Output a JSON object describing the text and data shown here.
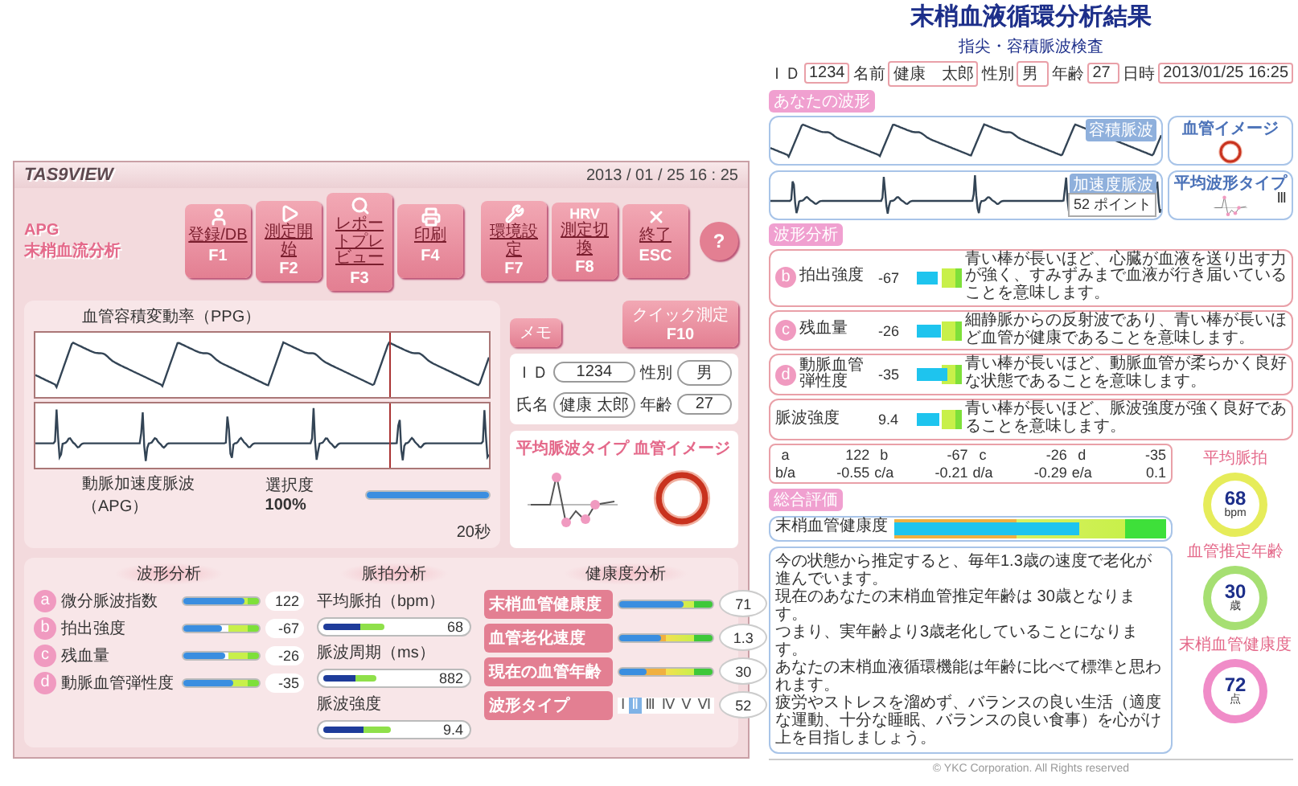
{
  "screen": {
    "app_title": "TAS9VIEW",
    "datetime": "2013 / 01 / 25  16 : 25",
    "logo": {
      "line1": "APG",
      "line2": "末梢血流分析"
    },
    "toolbar": [
      {
        "kind": "person",
        "label": "登録/DB",
        "key": "F1"
      },
      {
        "kind": "play",
        "label": "測定開始",
        "key": "F2"
      },
      {
        "kind": "search",
        "label": "レポートプレビュー",
        "key": "F3"
      },
      {
        "kind": "print",
        "label": "印刷",
        "key": "F4"
      },
      {
        "kind": "tools",
        "label": "環境設定",
        "key": "F7"
      },
      {
        "kind": "hrv",
        "badge": "HRV",
        "label": "測定切換",
        "key": "F8"
      },
      {
        "kind": "close",
        "label": "終了",
        "key": "ESC"
      }
    ],
    "help": "?",
    "ppg_title": "血管容積変動率（PPG）",
    "apg_title": "動脈加速度脈波（APG）",
    "quality": {
      "label": "選択度",
      "value": "100%",
      "level": 1
    },
    "duration": "20秒",
    "memo_button": "メモ",
    "quick_button": {
      "label": "クイック測定",
      "key": "F10"
    },
    "patient": [
      {
        "label": "ＩＤ",
        "value": "1234"
      },
      {
        "label": "性別",
        "value": "男"
      },
      {
        "label": "氏名",
        "value": "健康 太郎"
      },
      {
        "label": "年齢",
        "value": "27"
      }
    ],
    "type_title": "平均脈波タイプ",
    "vessel_title": "血管イメージ",
    "waveform_analysis": {
      "title": "波形分析",
      "rows": [
        {
          "letter": "a",
          "label": "微分脈波指数",
          "value": "122",
          "level": 0.8
        },
        {
          "letter": "b",
          "label": "拍出強度",
          "value": "-67",
          "level": 0.5
        },
        {
          "letter": "c",
          "label": "残血量",
          "value": "-26",
          "level": 0.55
        },
        {
          "letter": "d",
          "label": "動脈血管弾性度",
          "value": "-35",
          "level": 0.67
        }
      ]
    },
    "pulse_analysis": {
      "title": "脈拍分析",
      "rows": [
        {
          "label": "平均脈拍（bpm）",
          "value": "68",
          "level": 0.4
        },
        {
          "label": "脈波周期（ms）",
          "value": "882",
          "level": 0.35
        },
        {
          "label": "脈波強度",
          "value": "9.4",
          "level": 0.45
        }
      ]
    },
    "health_analysis": {
      "title": "健康度分析",
      "rows": [
        {
          "kind": "bar",
          "label": "末梢血管健康度",
          "value": "71",
          "level": 0.68
        },
        {
          "kind": "bar",
          "label": "血管老化速度",
          "value": "1.3",
          "level": 0.45
        },
        {
          "kind": "bar",
          "label": "現在の血管年齢",
          "value": "30",
          "level": 0.3
        },
        {
          "kind": "types",
          "label": "波形タイプ",
          "value": "52",
          "types": [
            {
              "label": "Ⅰ",
              "selected": false
            },
            {
              "label": "Ⅱ",
              "selected": true
            },
            {
              "label": "Ⅲ",
              "selected": false
            },
            {
              "label": "Ⅳ",
              "selected": false
            },
            {
              "label": "Ⅴ",
              "selected": false
            },
            {
              "label": "Ⅵ",
              "selected": false
            }
          ]
        }
      ]
    }
  },
  "report": {
    "title": "末梢血液循環分析結果",
    "subtitle": "指尖・容積脈波検査",
    "fields": [
      {
        "label": "ＩＤ",
        "value": "1234"
      },
      {
        "label": "名前",
        "value": "健康　太郎"
      },
      {
        "label": "性別",
        "value": "男"
      },
      {
        "label": "年齢",
        "value": "27"
      },
      {
        "label": "日時",
        "value": "2013/01/25 16:25"
      }
    ],
    "wave_section": "あなたの波形",
    "ppg_label": "容積脈波",
    "apg_label": "加速度脈波",
    "points": {
      "value": "52",
      "unit": "ポイント"
    },
    "vessel_title": "血管イメージ",
    "type_title": "平均波形タイプ",
    "type_value": "Ⅲ",
    "analysis_section": "波形分析",
    "analysis": [
      {
        "letter": "b",
        "label": "拍出強度",
        "value": "-67",
        "level": 0.45,
        "description": "青い棒が長いほど、心臓が血液を送り出す力が強く、すみずみまで血液が行き届いていることを意味します。"
      },
      {
        "letter": "c",
        "label": "残血量",
        "value": "-26",
        "level": 0.55,
        "description": "細静脈からの反射波であり、青い棒が長いほど血管が健康であることを意味します。"
      },
      {
        "letter": "d",
        "label": "動脈血管弾性度",
        "value": "-35",
        "level": 0.68,
        "description": "青い棒が長いほど、動脈血管が柔らかく良好な状態であることを意味します。"
      },
      {
        "label": "脈波強度",
        "value": "9.4",
        "level": 0.5,
        "description": "青い棒が長いほど、脈波強度が強く良好であることを意味します。"
      }
    ],
    "params": [
      {
        "label": "a",
        "value": "122"
      },
      {
        "label": "b",
        "value": "-67"
      },
      {
        "label": "c",
        "value": "-26"
      },
      {
        "label": "d",
        "value": "-35"
      },
      {
        "label": "b/a",
        "value": "-0.55"
      },
      {
        "label": "c/a",
        "value": "-0.21"
      },
      {
        "label": "d/a",
        "value": "-0.29"
      },
      {
        "label": "e/a",
        "value": "0.1"
      }
    ],
    "overall_section": "総合評価",
    "overall": {
      "label": "末梢血管健康度",
      "level": 0.68
    },
    "comment": [
      "今の状態から推定すると、毎年1.3歳の速度で老化が進んでいます。",
      "現在のあなたの末梢血管推定年齢は 30歳となります。",
      "つまり、実年齢より3歳老化していることになります。",
      "あなたの末梢血液循環機能は年齢に比べて標準と思われます。",
      "疲労やストレスを溜めず、バランスの良い生活（適度な運動、十分な睡眠、バランスの良い食事）を心がけ上を目指しましょう。"
    ],
    "badges": [
      {
        "title": "平均脈拍",
        "value": "68",
        "unit": "bpm",
        "color": "#e6ec5a"
      },
      {
        "title": "血管推定年齢",
        "value": "30",
        "unit": "歳",
        "color": "#a6df72"
      },
      {
        "title": "末梢血管健康度",
        "value": "72",
        "unit": "点",
        "color": "#f08cc8"
      }
    ],
    "footer": "© YKC Corporation. All Rights reserved"
  }
}
